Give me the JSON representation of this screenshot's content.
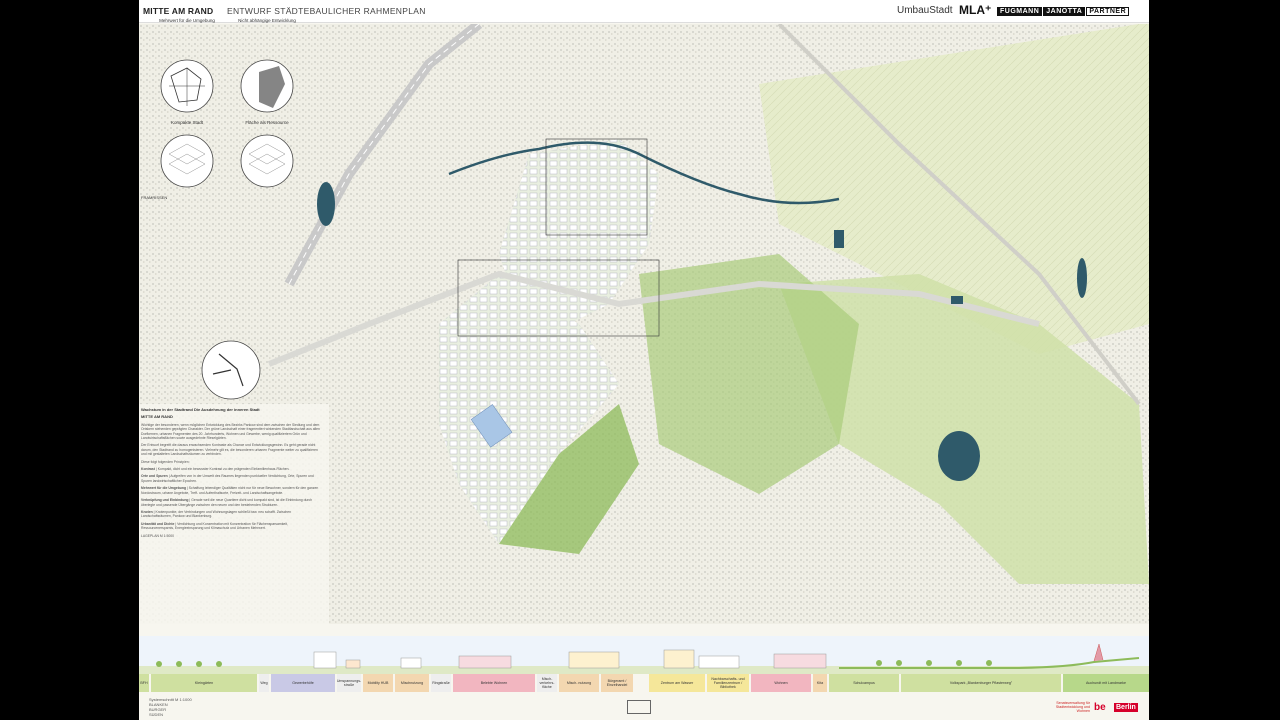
{
  "header": {
    "title": "MITTE AM RAND",
    "subtitle": "ENTWURF STÄDTEBAULICHER RAHMENPLAN",
    "brand_umbaustadt": "UmbauStadt",
    "brand_mla": "MLA⁺",
    "brand_fjp": [
      "FUGMANN",
      "JANOTTA",
      "PARTNER"
    ]
  },
  "pictograms": [
    {
      "label": "Mehrwert für die Umgebung"
    },
    {
      "label": "Nicht abhängige Entwicklung"
    },
    {
      "label": "Kompakte Stadt"
    },
    {
      "label": "Fläche als Ressource"
    }
  ],
  "map_label": "FRAMRISSEN",
  "textblock": {
    "heading": "Wachstum in der Stadtrand Die Ausdehnung der inneren Stadt",
    "section": "MITTE AM RAND",
    "intro": "Wichtige der besonderen, wenn möglichen Entwicklung des Bezirks Pankow sind dem zwischen der Siedlung und dem Ortskern stehenden geprägten Charakter. Der grüne Landschaft einer fragmentiert wirkenden Stadtlandschaft aus allen Dorfkernen, urbanen Fragmenten des 20. Jahrhunderts, Wohnen und Gewerbe, wenig qualifiziertem Grün und Landwirtschaftsflächen sowie ausgedehnte Rieselgärten.",
    "para2": "Der Entwurf begreift die daraus erwachsenden Kontraste als Chance und Entwicklungsgewinn. Es geht gerade nicht darum, den Stadtrand zu homogenisieren. Vielmehr gilt es, die besonderen urbanen Fragmente weiter zu qualifizieren und mit gestalteten Landschaftsräumen zu verbinden.",
    "para3": "Diese folgt folgenden Prinzipien:",
    "points": [
      {
        "k": "Kontrast",
        "v": "Kompakt, dicht und ein bewusster Kontrast zu den prägenden Einfamilienhaus-Flächen."
      },
      {
        "k": "Orte und Spuren",
        "v": "Aufgreifen von in der Umwelt des Raumes liegenden punktueller Verdichtung, Orte, Spuren und Spuren landwirtschaftlicher Epochen."
      },
      {
        "k": "Mehrwert für die Umgebung",
        "v": "Schaffung lebendiger Qualitäten nicht nur für neue Bewohner, sondern für den ganzen Nordostraum, urbane Angebote, Treff- und Aufenthaltsorte, Freizeit- und Landschaftsangebote."
      },
      {
        "k": "Verknüpfung und Einbindung",
        "v": "Gerade weil die neue Quartiere dicht und kompakt sind, ist die Einbindung durch überlegte und passende Übergänge zwischen den neuen und den bestehenden Strukturen."
      },
      {
        "k": "Knoten",
        "v": "Knotenpunkte, der Verbindungen und Wohnungslagen schließt bzw. neu schafft. Zwischen Landschaftsräumen, Pankow und Blankenburg."
      },
      {
        "k": "Urbanität und Dichte",
        "v": "Verdichtung und Konzentration mit Konzentration für Flächensparsamkeit, Ressourcenersparnis, Energieeinsparung und Klimaschutz und Urbanen Mehrwert."
      }
    ],
    "scale": "LAGEPLAN M 1:5000"
  },
  "section_strip": {
    "segments": [
      {
        "label": "BFH",
        "color": "#cfe0a0"
      },
      {
        "label": "Kleingärten",
        "color": "#cfe0a0"
      },
      {
        "label": "Weg",
        "color": "#eeeeee"
      },
      {
        "label": "Gewerbehöfe",
        "color": "#c9c9e6"
      },
      {
        "label": "Umspannungs- straße",
        "color": "#eeeeee"
      },
      {
        "label": "Mobility HUB",
        "color": "#f3d7b0"
      },
      {
        "label": "Mischnutzung",
        "color": "#f3d7b0"
      },
      {
        "label": "Ringstraße",
        "color": "#eeeeee"
      },
      {
        "label": "Belebte Wohnen",
        "color": "#f2b6c0"
      },
      {
        "label": "Misch- verkehrs- fläche",
        "color": "#eeeeee"
      },
      {
        "label": "Misch- nutzung",
        "color": "#f3d7b0"
      },
      {
        "label": "Bürgeramt / Einzelhandel",
        "color": "#f3d7b0"
      },
      {
        "label": "Zentrum am Wasser",
        "color": "#f5e79a"
      },
      {
        "label": "Nachbarschafts- und Familienzentrum / Bibliothek",
        "color": "#f5e79a"
      },
      {
        "label": "Wohnen",
        "color": "#f2b6c0"
      },
      {
        "label": "Kita",
        "color": "#f3d7b0"
      },
      {
        "label": "Schulcampus",
        "color": "#cfe0a0"
      },
      {
        "label": "Volkspark „Blankenburger Pflasterweg\"",
        "color": "#cfe0a0"
      },
      {
        "label": "Auchundt mit Landmarke",
        "color": "#b7d88a"
      }
    ],
    "caption": "Systemschnitt M 1:1000"
  },
  "footer": {
    "team": [
      "BLANKEN",
      "BURGER",
      "SÜDEN"
    ],
    "admin": "Senatsverwaltung für Stadtentwicklung und Wohnen",
    "logo_be": "be",
    "logo_berlin": "Berlin"
  },
  "colors": {
    "water": "#2f5a6a",
    "green": "#8dbb5a",
    "paper": "#f7f6ef"
  }
}
